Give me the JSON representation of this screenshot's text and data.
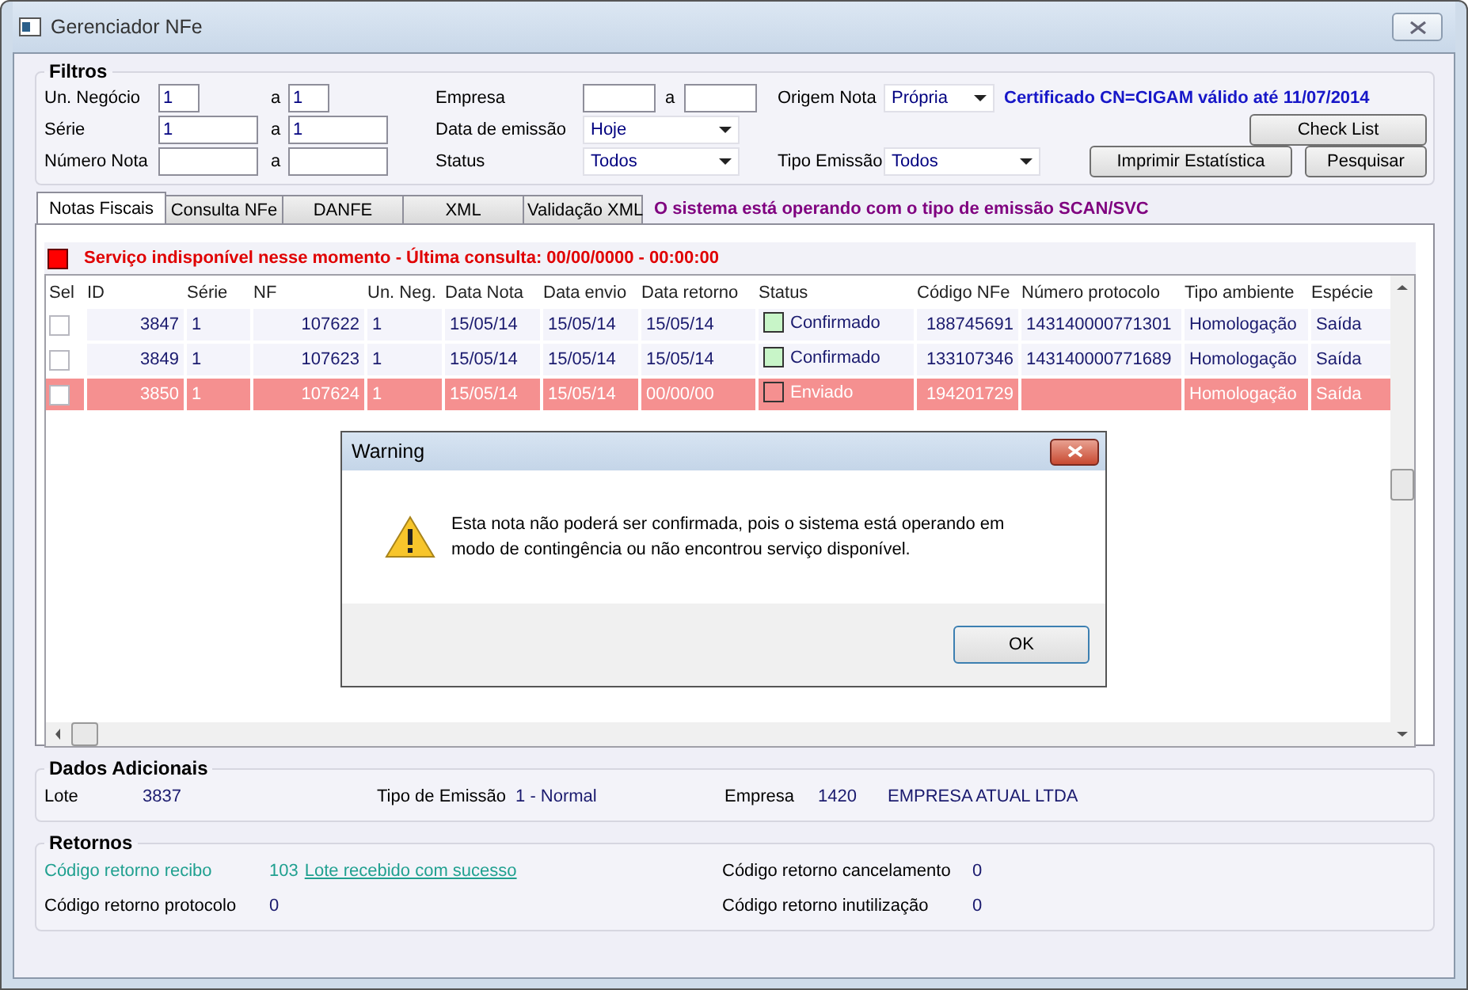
{
  "window": {
    "title": "Gerenciador NFe"
  },
  "filters": {
    "title": "Filtros",
    "un_negocio": {
      "label": "Un. Negócio",
      "from": "1",
      "sep": "a",
      "to": "1"
    },
    "serie": {
      "label": "Série",
      "from": "1",
      "sep": "a",
      "to": "1"
    },
    "numero_nota": {
      "label": "Número Nota",
      "sep": "a"
    },
    "empresa": {
      "label": "Empresa",
      "sep": "a"
    },
    "data_emissao": {
      "label": "Data de emissão",
      "value": "Hoje"
    },
    "status": {
      "label": "Status",
      "value": "Todos"
    },
    "origem_nota": {
      "label": "Origem Nota",
      "value": "Própria"
    },
    "tipo_emissao": {
      "label": "Tipo Emissão",
      "value": "Todos"
    },
    "certificate": "Certificado CN=CIGAM válido até 11/07/2014",
    "buttons": {
      "check_list": "Check List",
      "imprimir": "Imprimir Estatística",
      "pesquisar": "Pesquisar"
    }
  },
  "tabs": [
    {
      "label": "Notas Fiscais",
      "selected": true
    },
    {
      "label": "Consulta NFe",
      "selected": false
    },
    {
      "label": "DANFE",
      "selected": false
    },
    {
      "label": "XML",
      "selected": false
    },
    {
      "label": "Validação XML",
      "selected": false
    }
  ],
  "mode_notice": "O sistema está operando com o tipo de emissão SCAN/SVC",
  "service_status": {
    "color": "#ff0000",
    "text": "Serviço indisponível nesse momento - Última consulta: 00/00/0000 - 00:00:00"
  },
  "table": {
    "columns": [
      "Sel",
      "ID",
      "Série",
      "NF",
      "Un. Neg.",
      "Data Nota",
      "Data envio",
      "Data retorno",
      "Status",
      "Código NFe",
      "Número protocolo",
      "Tipo ambiente",
      "Espécie"
    ],
    "rows": [
      {
        "checked": false,
        "selected": false,
        "color": "#c8f5c8",
        "cells": [
          "",
          "3847",
          "1",
          "107622",
          "1",
          "15/05/14",
          "15/05/14",
          "15/05/14",
          "Confirmado",
          "188745691",
          "143140000771301",
          "Homologação",
          "Saída"
        ]
      },
      {
        "checked": false,
        "selected": false,
        "color": "#c8f5c8",
        "cells": [
          "",
          "3849",
          "1",
          "107623",
          "1",
          "15/05/14",
          "15/05/14",
          "15/05/14",
          "Confirmado",
          "133107346",
          "143140000771689",
          "Homologação",
          "Saída"
        ]
      },
      {
        "checked": false,
        "selected": true,
        "color": "#f59090",
        "cells": [
          "",
          "3850",
          "1",
          "107624",
          "1",
          "15/05/14",
          "15/05/14",
          "00/00/00",
          "Enviado",
          "194201729",
          "",
          "Homologação",
          "Saída"
        ]
      }
    ]
  },
  "dados_adicionais": {
    "title": "Dados Adicionais",
    "lote_label": "Lote",
    "lote": "3837",
    "tipo_label": "Tipo de Emissão",
    "tipo": "1 - Normal",
    "empresa_label": "Empresa",
    "empresa_code": "1420",
    "empresa_name": "EMPRESA ATUAL LTDA"
  },
  "retornos": {
    "title": "Retornos",
    "recibo_label": "Código retorno recibo",
    "recibo_code": "103",
    "recibo_link": "Lote recebido com sucesso",
    "protocolo_label": "Código retorno protocolo",
    "protocolo": "0",
    "cancelamento_label": "Código retorno cancelamento",
    "cancelamento": "0",
    "inutilizacao_label": "Código retorno inutilização",
    "inutilizacao": "0"
  },
  "dialog": {
    "title": "Warning",
    "message": "Esta nota não poderá ser confirmada, pois o sistema está operando em modo de contingência ou não encontrou serviço disponível.",
    "button": "OK"
  }
}
